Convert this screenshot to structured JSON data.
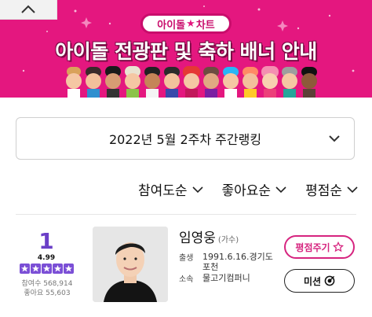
{
  "banner": {
    "pill_left": "아이돌",
    "pill_right": "차트",
    "title": "아이돌 전광판 및 축하 배너 안내"
  },
  "week_select": {
    "label": "2022년 5월 2주차 주간랭킹"
  },
  "sort_options": [
    {
      "label": "참여도순"
    },
    {
      "label": "좋아요순"
    },
    {
      "label": "평점순"
    }
  ],
  "ranking": {
    "rank": "1",
    "score": "4.99",
    "stars": 5,
    "participation": "참여수 568,914",
    "likes": "좋아요 55,603",
    "artist_name": "임영웅",
    "artist_role": "(가수)",
    "birth_label": "출생",
    "birth_value_line1": "1991.6.16.경기도",
    "birth_value_line2": "포천",
    "agency_label": "소속",
    "agency_value": "물고기컴퍼니",
    "rate_button": "평점주기",
    "mission_button": "미션"
  },
  "colors": {
    "banner": "#e4177f",
    "accent_purple": "#6b3fc7",
    "star": "#7b4fd6",
    "rate_pink": "#d6247f"
  },
  "icons": [
    "chevron-up-icon",
    "chevron-down-icon",
    "star-outline-icon",
    "target-icon"
  ]
}
